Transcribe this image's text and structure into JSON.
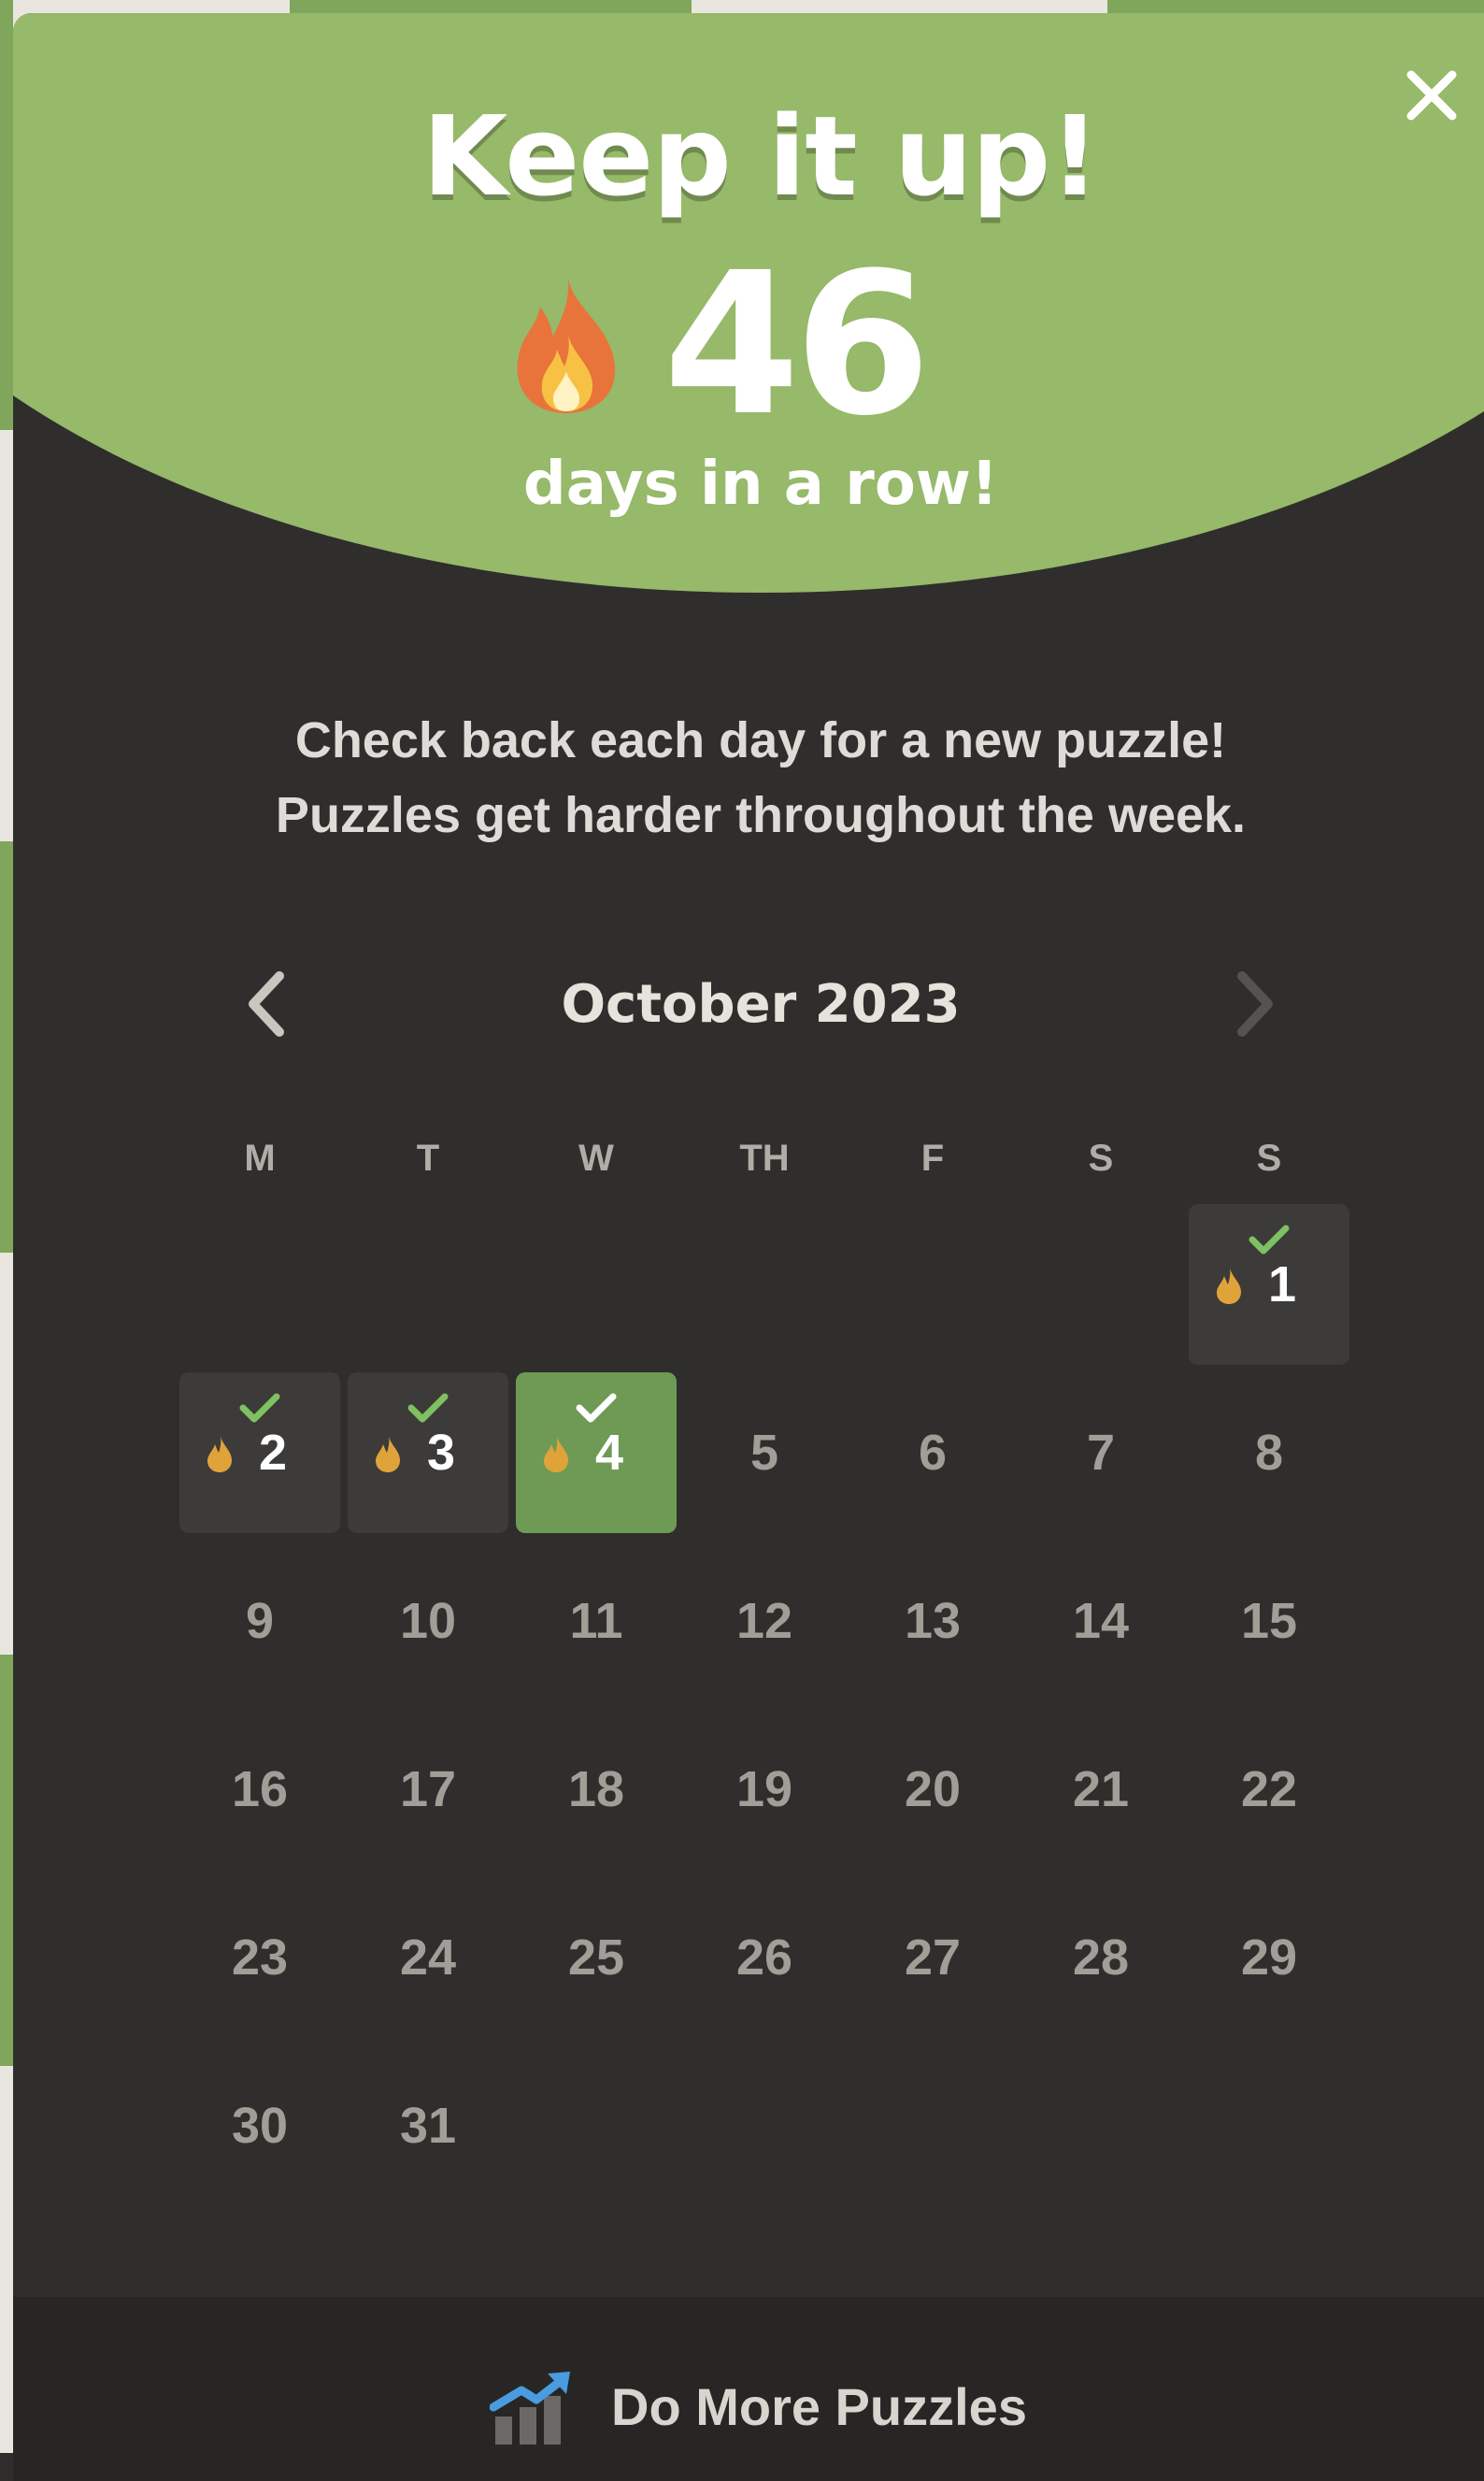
{
  "modal": {
    "title": "Keep it up!",
    "streak_count": "46",
    "streak_label": "days in a row!",
    "description_line1": "Check back each day for a new puzzle!",
    "description_line2": "Puzzles get harder throughout the week."
  },
  "icons": {
    "close": "close-icon",
    "flame": "flame-icon",
    "prev": "chevron-left-icon",
    "next": "chevron-right-icon",
    "check": "check-icon",
    "chart": "chart-icon"
  },
  "calendar": {
    "month_label": "October 2023",
    "weekdays": [
      "M",
      "T",
      "W",
      "TH",
      "F",
      "S",
      "S"
    ],
    "week1": [
      "",
      "",
      "",
      "",
      "",
      "",
      "1"
    ],
    "week2": [
      "2",
      "3",
      "4",
      "5",
      "6",
      "7",
      "8"
    ],
    "week3": [
      "9",
      "10",
      "11",
      "12",
      "13",
      "14",
      "15"
    ],
    "week4": [
      "16",
      "17",
      "18",
      "19",
      "20",
      "21",
      "22"
    ],
    "week5": [
      "23",
      "24",
      "25",
      "26",
      "27",
      "28",
      "29"
    ],
    "week6": [
      "30",
      "31",
      "",
      "",
      "",
      "",
      ""
    ],
    "completed_days": [
      "1",
      "2",
      "3",
      "4"
    ],
    "current_day": "4"
  },
  "footer": {
    "more_puzzles_label": "Do More Puzzles"
  },
  "colors": {
    "hero_green": "#96b96a",
    "today_green": "#6e9a55",
    "check_green": "#7fc061",
    "panel": "#2f2e2c",
    "completed_cell": "#3c3b39",
    "flame_orange": "#e8743b",
    "flame_gold": "#e0a33a"
  }
}
